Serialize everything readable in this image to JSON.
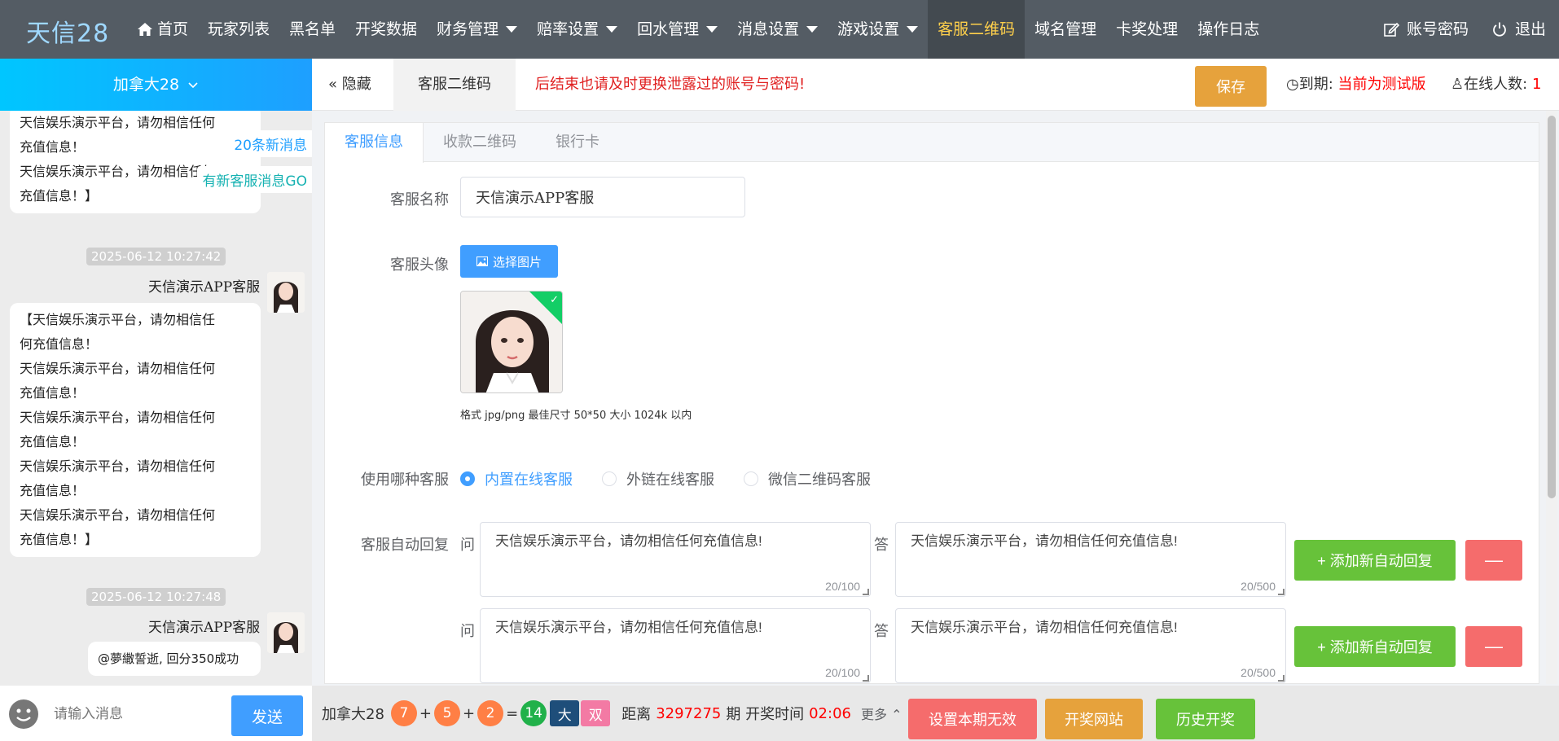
{
  "app": {
    "logo": "天信28"
  },
  "nav": {
    "items": [
      {
        "label": "首页"
      },
      {
        "label": "玩家列表"
      },
      {
        "label": "黑名单"
      },
      {
        "label": "开奖数据"
      },
      {
        "label": "财务管理"
      },
      {
        "label": "赔率设置"
      },
      {
        "label": "回水管理"
      },
      {
        "label": "消息设置"
      },
      {
        "label": "游戏设置"
      },
      {
        "label": "客服二维码"
      },
      {
        "label": "域名管理"
      },
      {
        "label": "卡奖处理"
      },
      {
        "label": "操作日志"
      }
    ],
    "account": "账号密码",
    "logout": "退出",
    "colors": {
      "bar": "#545c64",
      "active_text": "#ffd04b"
    }
  },
  "sidebar": {
    "game": "加拿大28",
    "new_messages": "20条新消息",
    "new_service": "有新客服消息GO",
    "messages": [
      {
        "lines": [
          "天信娱乐演示平台，请勿相信任何",
          "充值信息！",
          "天信娱乐演示平台，请勿相信任何",
          "充值信息！】"
        ]
      },
      {
        "time": "2025-06-12 10:27:42",
        "sender": "天信演示APP客服",
        "lines": [
          "【天信娱乐演示平台，请勿相信任",
          "何充值信息！",
          "天信娱乐演示平台，请勿相信任何",
          "充值信息！",
          "天信娱乐演示平台，请勿相信任何",
          "充值信息！",
          "天信娱乐演示平台，请勿相信任何",
          "充值信息！",
          "天信娱乐演示平台，请勿相信任何",
          "充值信息！】"
        ]
      },
      {
        "time": "2025-06-12 10:27:48",
        "sender": "天信演示APP客服",
        "lines": [
          "@夢繖誓逝, 回分350成功"
        ]
      }
    ],
    "input_placeholder": "请输入消息",
    "send": "发送"
  },
  "subbar": {
    "hide": "隐藏",
    "current_tab": "客服二维码",
    "notice": "后结束也请及时更换泄露过的账号与密码!",
    "save": "保存",
    "expire_label": "到期:",
    "expire_value": "当前为测试版",
    "online_label": "在线人数:",
    "online_value": "1"
  },
  "form": {
    "tabs": [
      "客服信息",
      "收款二维码",
      "银行卡"
    ],
    "name_label": "客服名称",
    "name_value": "天信演示APP客服",
    "avatar_label": "客服头像",
    "pick_image": "选择图片",
    "hint": "格式 jpg/png 最佳尺寸 50*50 大小 1024k 以内",
    "type_label": "使用哪种客服",
    "types": [
      "内置在线客服",
      "外链在线客服",
      "微信二维码客服"
    ],
    "selected_type": "内置在线客服",
    "auto_label": "客服自动回复",
    "q_letter": "问",
    "a_letter": "答",
    "replies": [
      {
        "q": "天信娱乐演示平台，请勿相信任何充值信息!",
        "q_count": "20/100",
        "a": "天信娱乐演示平台，请勿相信任何充值信息!",
        "a_count": "20/500"
      },
      {
        "q": "天信娱乐演示平台，请勿相信任何充值信息!",
        "q_count": "20/100",
        "a": "天信娱乐演示平台，请勿相信任何充值信息!",
        "a_count": "20/500"
      }
    ],
    "add_reply": "添加新自动回复",
    "remove": "—"
  },
  "lottery": {
    "game": "加拿大28",
    "balls": [
      "7",
      "5",
      "2"
    ],
    "sum": "14",
    "big": "大",
    "double": "双",
    "distance_label": "距离",
    "period": "3297275",
    "period_label": "期 开奖时间",
    "countdown": "02:06",
    "more": "更多",
    "btn_invalid": "设置本期无效",
    "btn_site": "开奖网站",
    "btn_history": "历史开奖",
    "colors": {
      "invalid": "#f56c6c",
      "site": "#e6a23c",
      "history": "#67c23a"
    }
  }
}
